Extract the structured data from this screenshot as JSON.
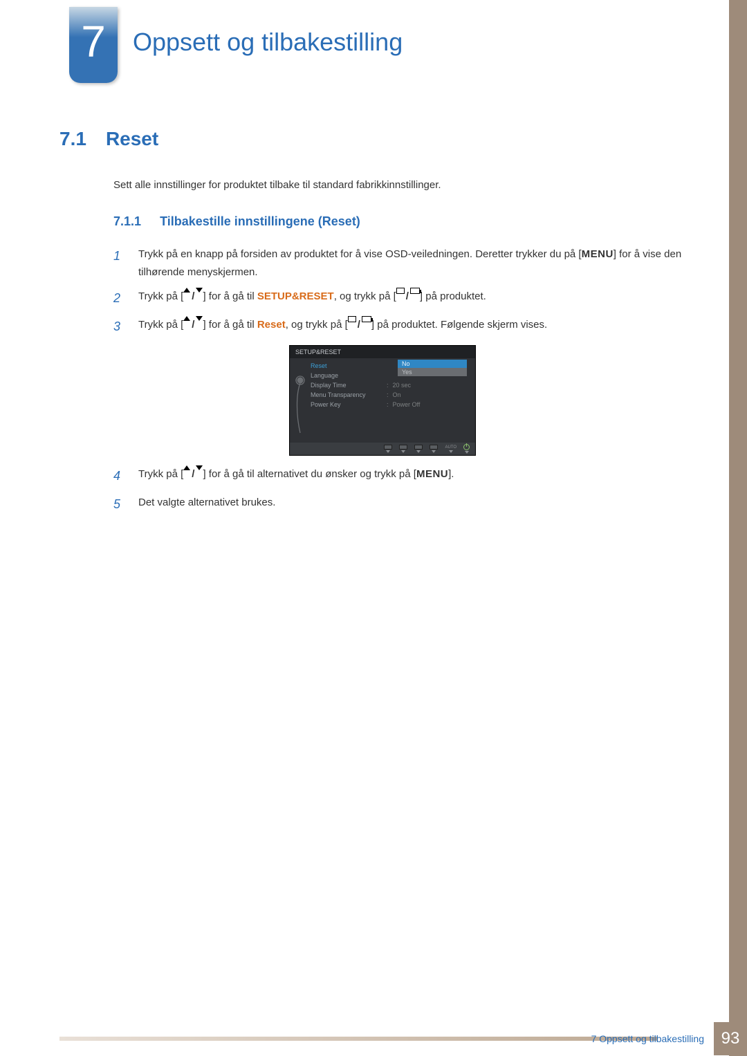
{
  "chapter": {
    "number": "7",
    "title": "Oppsett og tilbakestilling"
  },
  "section": {
    "number": "7.1",
    "title": "Reset"
  },
  "intro": "Sett alle innstillinger for produktet tilbake til standard fabrikkinnstillinger.",
  "subsection": {
    "number": "7.1.1",
    "title": "Tilbakestille innstillingene (Reset)"
  },
  "labels": {
    "menu": "MENU",
    "setup_reset": "SETUP&RESET",
    "reset": "Reset"
  },
  "steps": {
    "s1a": "Trykk på en knapp på forsiden av produktet for å vise OSD-veiledningen. Deretter trykker du på [",
    "s1b": "] for å vise den tilhørende menyskjermen.",
    "s2a": "Trykk på [",
    "s2b": "] for å gå til ",
    "s2c": ", og trykk på [",
    "s2d": "] på produktet.",
    "s3a": "Trykk på [",
    "s3b": "] for å gå til ",
    "s3c": ", og trykk på [",
    "s3d": "] på produktet. Følgende skjerm vises.",
    "s4a": "Trykk på [",
    "s4b": "] for å gå til alternativet du ønsker og trykk på [",
    "s4c": "].",
    "s5": "Det valgte alternativet brukes."
  },
  "osd": {
    "title": "SETUP&RESET",
    "items": {
      "reset": "Reset",
      "language": "Language",
      "display_time": "Display Time",
      "menu_transparency": "Menu Transparency",
      "power_key": "Power Key"
    },
    "values": {
      "display_time": "20 sec",
      "menu_transparency": "On",
      "power_key": "Power Off"
    },
    "options": {
      "no": "No",
      "yes": "Yes"
    },
    "bottom": {
      "auto": "AUTO"
    }
  },
  "footer": {
    "text": "7 Oppsett og tilbakestilling",
    "page": "93"
  }
}
